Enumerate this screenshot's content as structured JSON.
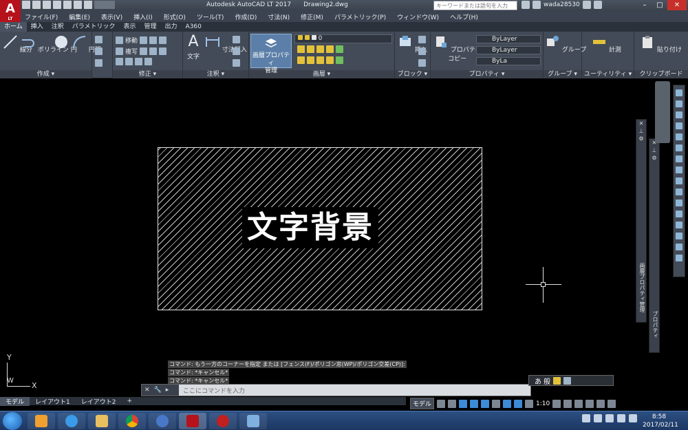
{
  "app": {
    "title": "Autodesk AutoCAD LT 2017",
    "document": "Drawing2.dwg",
    "logo_letter": "A",
    "logo_sub": "LT",
    "search_placeholder": "キーワードまたは語句を入力",
    "user": "wada28530"
  },
  "menu": [
    "ファイル(F)",
    "編集(E)",
    "表示(V)",
    "挿入(I)",
    "形式(O)",
    "ツール(T)",
    "作成(D)",
    "寸法(N)",
    "修正(M)",
    "パラメトリック(P)",
    "ウィンドウ(W)",
    "ヘルプ(H)"
  ],
  "ribbon_tabs": [
    "ホーム",
    "挿入",
    "注釈",
    "パラメトリック",
    "表示",
    "管理",
    "出力",
    "A360"
  ],
  "ribbon": {
    "draw": {
      "label": "作成 ▾",
      "line": "線分",
      "polyline": "ポリライン",
      "circle": "円",
      "arc": "円弧"
    },
    "modify": {
      "label": "修正 ▾",
      "move": "移動",
      "copy": "複写"
    },
    "annotation": {
      "label": "注釈 ▾",
      "text": "文字",
      "dimension": "寸法記入"
    },
    "layers": {
      "label": "画層 ▾",
      "properties_btn_1": "画層プロパティ",
      "properties_btn_2": "管理",
      "current_layer": "0"
    },
    "block": {
      "label": "ブロック ▾",
      "insert": "挿入"
    },
    "properties": {
      "label": "プロパティ ▾",
      "match_1": "プロパティ",
      "match_2": "コピー",
      "color": "ByLayer",
      "linetype": "ByLayer",
      "lineweight": "ByLa"
    },
    "groups": {
      "label": "グループ ▾",
      "group": "グループ"
    },
    "utilities": {
      "label": "ユーティリティ ▾",
      "measure": "計測"
    },
    "clipboard": {
      "label": "クリップボード",
      "paste": "貼り付け"
    }
  },
  "drawing": {
    "text": "文字背景"
  },
  "ucs": {
    "x": "X",
    "y": "Y",
    "w": "W"
  },
  "palettes": {
    "layer_properties": "画層プロパティ管理",
    "properties": "プロパティ"
  },
  "command_history": [
    "コマンド: もう一方のコーナーを指定 または [フェンス(F)/ポリゴン窓(WP)/ポリゴン交差(CP)]:",
    "コマンド: *キャンセル*",
    "コマンド: *キャンセル*"
  ],
  "command_line": {
    "placeholder": "ここにコマンドを入力"
  },
  "ime": {
    "mode": "あ 般"
  },
  "layout_tabs": [
    "モデル",
    "レイアウト1",
    "レイアウト2",
    "+"
  ],
  "status": {
    "model": "モデル",
    "scale": "1:10"
  },
  "clock": {
    "time": "8:58",
    "date": "2017/02/11"
  }
}
